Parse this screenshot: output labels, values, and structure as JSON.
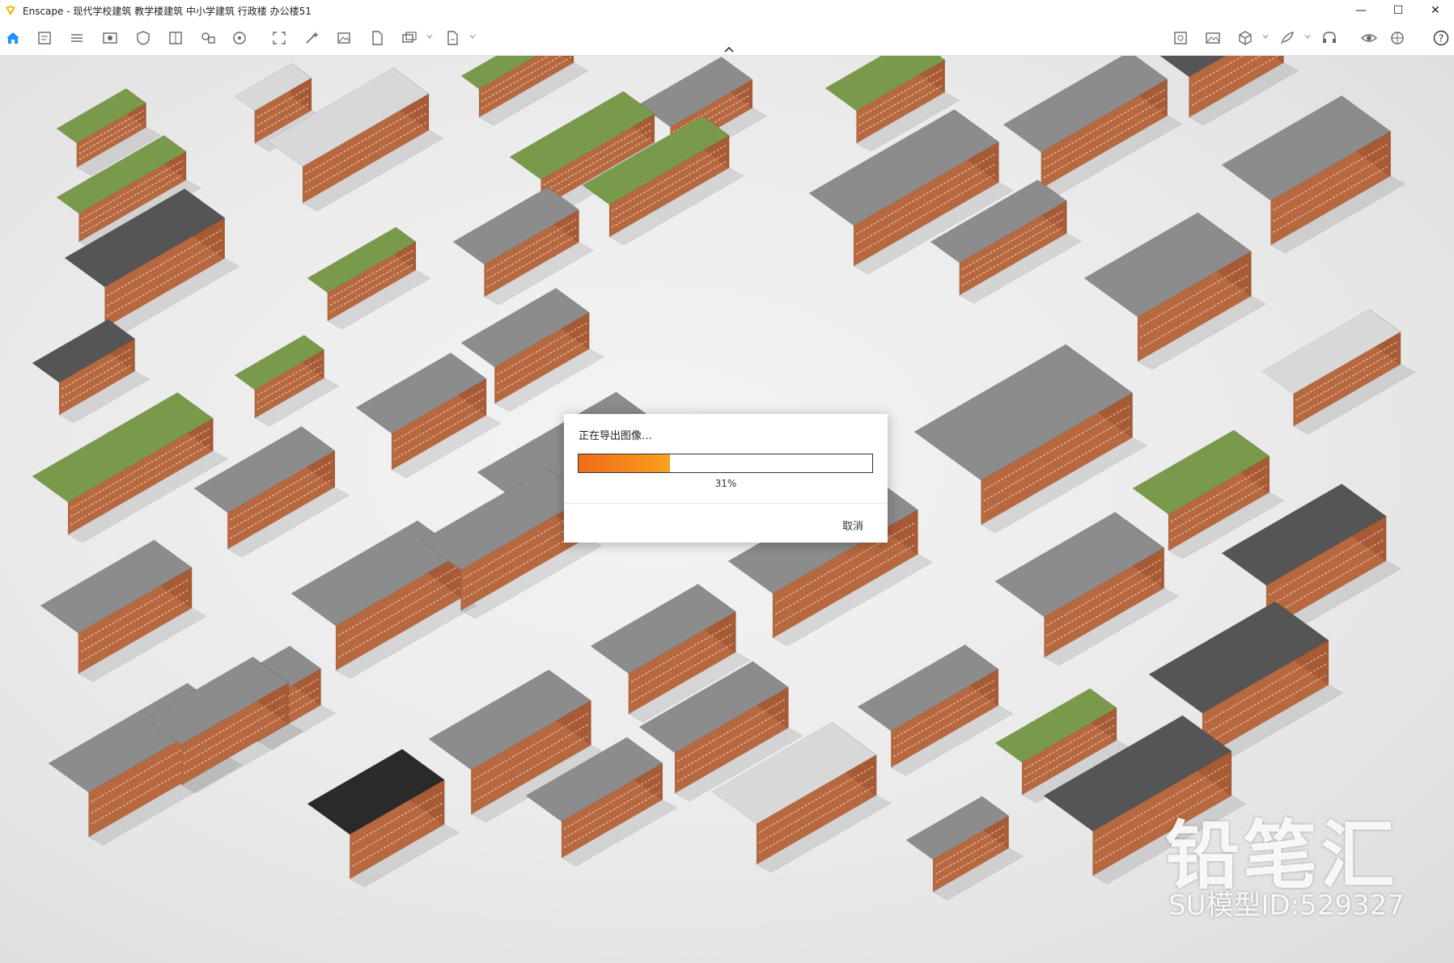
{
  "window": {
    "title": "Enscape - 现代学校建筑 教学楼建筑 中小学建筑 行政楼 办公楼51",
    "controls": [
      "minimize",
      "maximize",
      "close"
    ]
  },
  "toolbar": {
    "left_icons": [
      "home-icon",
      "asset-library-icon",
      "bim-icon",
      "view-icon",
      "safe-frame-icon",
      "book-icon",
      "video-editor-icon",
      "panorama-icon",
      "capture-icon",
      "settings-wand-icon",
      "image-export-icon",
      "document-export-icon",
      "batch-render-icon",
      "export-icon"
    ],
    "right_icons": [
      "screenshot-icon",
      "image-icon",
      "cube-icon",
      "feather-icon",
      "headset-icon",
      "eye-icon",
      "materials-icon",
      "help-icon"
    ],
    "help_label": "?",
    "accent": "#1e90ff"
  },
  "dialog": {
    "title": "正在导出图像…",
    "progress": 0.31,
    "percent_label": "31%",
    "cancel_label": "取消",
    "progress_color": "#f26a1b"
  },
  "watermark": {
    "brand": "铅笔汇",
    "model_id": "SU模型ID:529327"
  },
  "colors": {
    "brick": "#b8683f",
    "roof": "#8c8c8c",
    "green_roof": "#7a9a4b",
    "ground": "#ececec"
  }
}
